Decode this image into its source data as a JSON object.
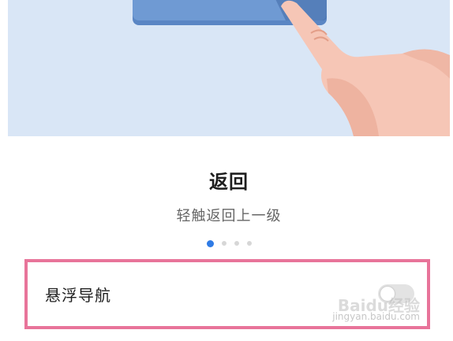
{
  "guide": {
    "title": "返回",
    "subtitle": "轻触返回上一级",
    "pagination": {
      "total": 4,
      "active_index": 0
    }
  },
  "setting_row": {
    "label": "悬浮导航",
    "toggle_on": false
  },
  "watermark": {
    "logo_text": "Baidu经验",
    "url_text": "jingyan.baidu.com"
  },
  "colors": {
    "illustration_bg": "#d9e6f6",
    "accent": "#2f7be5",
    "highlight_border": "#e8749a",
    "hand_skin": "#f5c4b4",
    "button_blue": "#6f9ad3"
  },
  "icons": {
    "illustration": "hand-tapping-icon"
  }
}
